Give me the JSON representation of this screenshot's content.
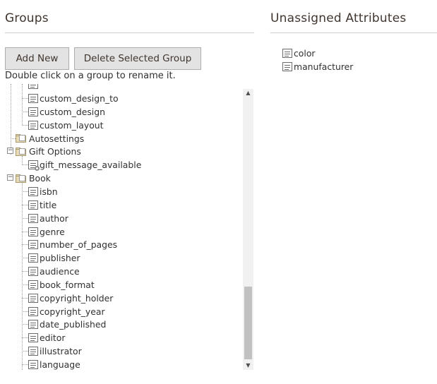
{
  "groups_panel": {
    "title": "Groups",
    "add_new_label": "Add New",
    "delete_label": "Delete Selected Group",
    "hint": "Double click on a group to rename it."
  },
  "unassigned_panel": {
    "title": "Unassigned Attributes",
    "items": [
      {
        "label": "color"
      },
      {
        "label": "manufacturer"
      }
    ]
  },
  "tree": {
    "rows": [
      {
        "label": "custom_design_to",
        "kind": "attribute",
        "level": 2
      },
      {
        "label": "custom_design",
        "kind": "attribute",
        "level": 2
      },
      {
        "label": "custom_layout",
        "kind": "attribute",
        "level": 2
      },
      {
        "label": "Autosettings",
        "kind": "group",
        "level": 1,
        "expanded": false
      },
      {
        "label": "Gift Options",
        "kind": "group",
        "level": 1,
        "expanded": true
      },
      {
        "label": "gift_message_available",
        "kind": "attribute-system",
        "level": 2
      },
      {
        "label": "Book",
        "kind": "group",
        "level": 1,
        "expanded": true
      },
      {
        "label": "isbn",
        "kind": "attribute",
        "level": 2
      },
      {
        "label": "title",
        "kind": "attribute",
        "level": 2
      },
      {
        "label": "author",
        "kind": "attribute",
        "level": 2
      },
      {
        "label": "genre",
        "kind": "attribute",
        "level": 2
      },
      {
        "label": "number_of_pages",
        "kind": "attribute",
        "level": 2
      },
      {
        "label": "publisher",
        "kind": "attribute",
        "level": 2
      },
      {
        "label": "audience",
        "kind": "attribute",
        "level": 2
      },
      {
        "label": "book_format",
        "kind": "attribute",
        "level": 2
      },
      {
        "label": "copyright_holder",
        "kind": "attribute",
        "level": 2
      },
      {
        "label": "copyright_year",
        "kind": "attribute",
        "level": 2
      },
      {
        "label": "date_published",
        "kind": "attribute",
        "level": 2
      },
      {
        "label": "editor",
        "kind": "attribute",
        "level": 2
      },
      {
        "label": "illustrator",
        "kind": "attribute",
        "level": 2
      },
      {
        "label": "language",
        "kind": "attribute",
        "level": 2
      }
    ],
    "collapse_glyph": "−",
    "expand_glyph": "+"
  },
  "scrollbar": {
    "up_arrow": "▲",
    "down_arrow": "▼",
    "scroll_position": 0.7
  }
}
